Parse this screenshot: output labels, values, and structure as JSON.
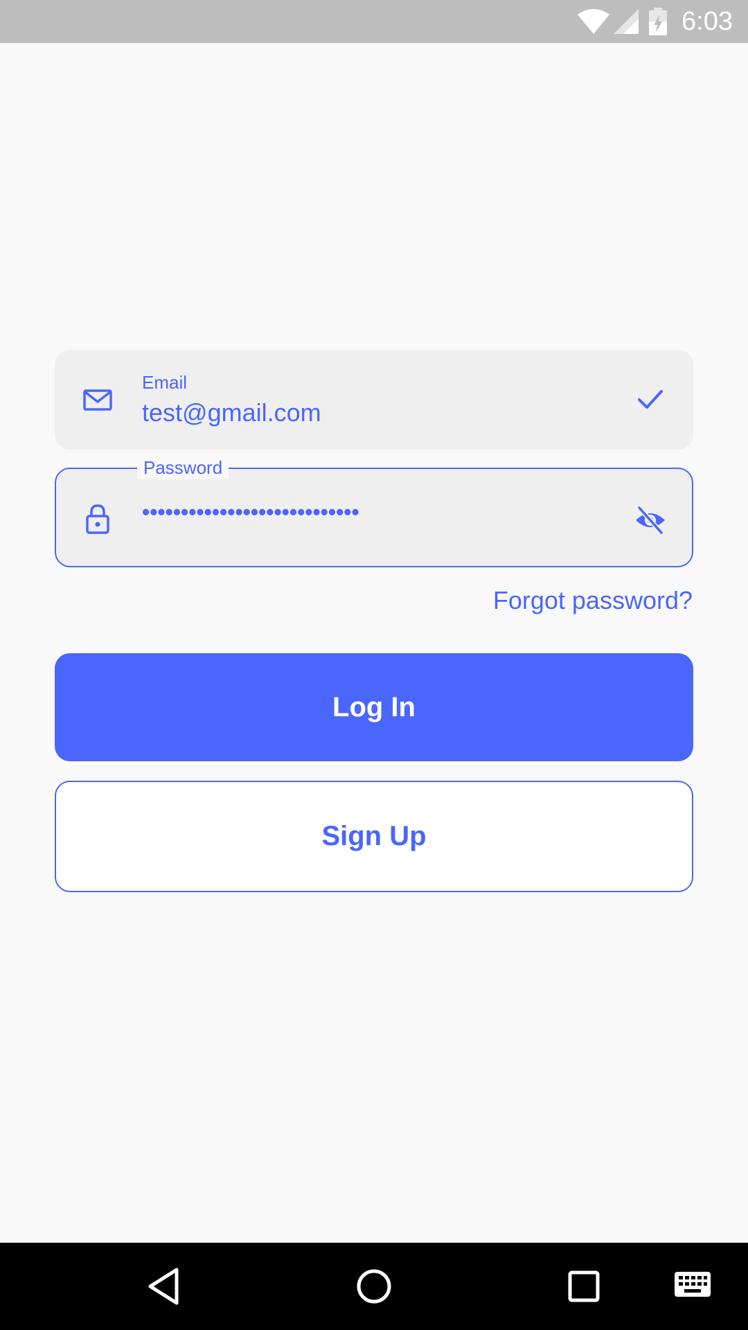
{
  "status_bar": {
    "time": "6:03",
    "icons": [
      "wifi-icon",
      "cell-signal-icon",
      "battery-charging-icon"
    ]
  },
  "form": {
    "email": {
      "label": "Email",
      "value": "test@gmail.com",
      "icon": "mail-icon",
      "trailing_icon": "check-icon"
    },
    "password": {
      "label": "Password",
      "masked_value": "••••••••••••••••••••••••••••",
      "icon": "lock-icon",
      "trailing_icon": "visibility-off-icon"
    },
    "forgot_password": "Forgot password?",
    "login_label": "Log In",
    "signup_label": "Sign Up"
  },
  "nav_bar": {
    "icons": [
      "back-icon",
      "home-icon",
      "recents-icon",
      "keyboard-icon"
    ]
  },
  "colors": {
    "accent": "#4b66fc",
    "field_background": "#efefef",
    "page_background": "#f9f9f9",
    "status_bar": "#bdbdbd",
    "nav_bar": "#000000"
  }
}
